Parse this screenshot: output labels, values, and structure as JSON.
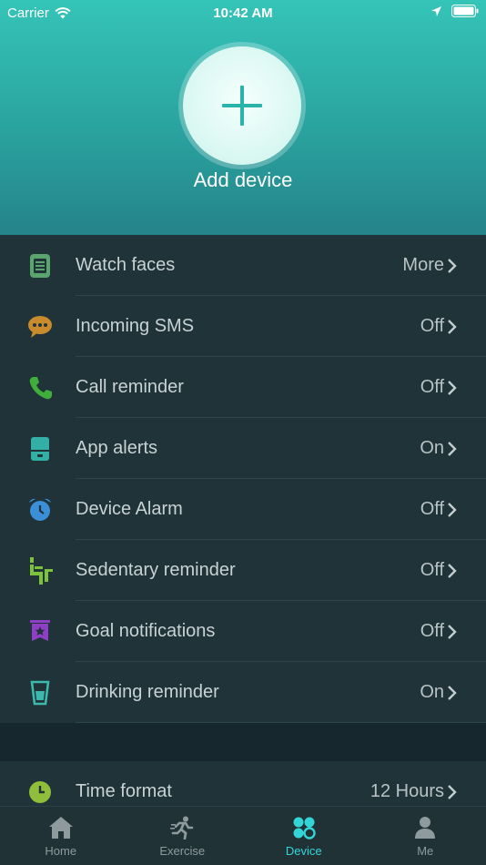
{
  "status_bar": {
    "carrier": "Carrier",
    "time": "10:42 AM"
  },
  "header": {
    "add_device_label": "Add device"
  },
  "settings": [
    {
      "label": "Watch faces",
      "value": "More",
      "icon": "watch-face-icon",
      "color": "#5aa56e"
    },
    {
      "label": "Incoming SMS",
      "value": "Off",
      "icon": "sms-bubble-icon",
      "color": "#c98b2c"
    },
    {
      "label": "Call reminder",
      "value": "Off",
      "icon": "phone-icon",
      "color": "#3fae3a"
    },
    {
      "label": "App alerts",
      "value": "On",
      "icon": "app-alert-icon",
      "color": "#33b0a6"
    },
    {
      "label": "Device Alarm",
      "value": "Off",
      "icon": "alarm-clock-icon",
      "color": "#3a8fd6"
    },
    {
      "label": "Sedentary reminder",
      "value": "Off",
      "icon": "sedentary-icon",
      "color": "#7cc23a"
    },
    {
      "label": "Goal notifications",
      "value": "Off",
      "icon": "goal-star-icon",
      "color": "#8e3fc6"
    },
    {
      "label": "Drinking reminder",
      "value": "On",
      "icon": "drinking-cup-icon",
      "color": "#3cb8ac"
    }
  ],
  "time_format": {
    "label": "Time format",
    "value": "12 Hours",
    "icon": "clock-icon",
    "color": "#8fbf3a"
  },
  "tabs": [
    {
      "label": "Home",
      "icon": "home-icon",
      "active": false
    },
    {
      "label": "Exercise",
      "icon": "running-icon",
      "active": false
    },
    {
      "label": "Device",
      "icon": "device-icon",
      "active": true
    },
    {
      "label": "Me",
      "icon": "person-icon",
      "active": false
    }
  ],
  "colors": {
    "accent": "#33d6d8",
    "header_top": "#35c4b8",
    "background": "#1e3036"
  }
}
